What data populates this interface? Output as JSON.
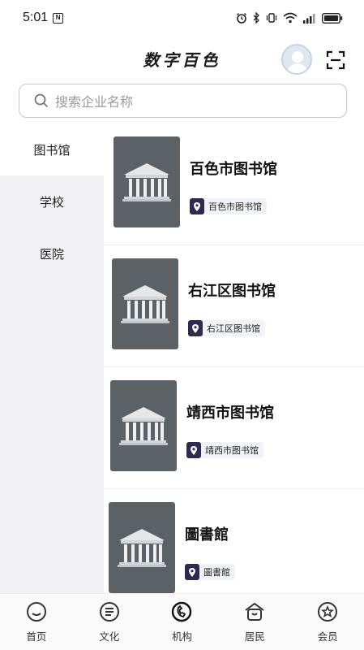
{
  "status_bar": {
    "time": "5:01",
    "nfc_label": "N",
    "icons": [
      "alarm-icon",
      "bluetooth-icon",
      "vibrate-icon",
      "wifi-icon",
      "signal-icon",
      "battery-icon"
    ]
  },
  "header": {
    "title": "数字百色",
    "avatar_icon": "user-avatar",
    "scan_icon": "scan-icon"
  },
  "search": {
    "placeholder": "搜索企业名称"
  },
  "sidebar": {
    "items": [
      {
        "label": "图书馆",
        "active": true
      },
      {
        "label": "学校",
        "active": false
      },
      {
        "label": "医院",
        "active": false
      }
    ]
  },
  "libraries": [
    {
      "title": "百色市图书馆",
      "location": "百色市图书馆"
    },
    {
      "title": "右江区图书馆",
      "location": "右江区图书馆"
    },
    {
      "title": "靖西市图书馆",
      "location": "靖西市图书馆"
    },
    {
      "title": "圖書館",
      "location": "圖書館"
    }
  ],
  "tabbar": {
    "tabs": [
      {
        "label": "首页",
        "icon": "home-icon"
      },
      {
        "label": "文化",
        "icon": "culture-icon"
      },
      {
        "label": "机构",
        "icon": "institution-icon",
        "active": true
      },
      {
        "label": "居民",
        "icon": "residents-icon"
      },
      {
        "label": "会员",
        "icon": "member-icon"
      }
    ]
  },
  "colors": {
    "sidebar_bg": "#f2f2f4",
    "thumb_bg": "#5b6165",
    "badge_pin": "#2d2b52",
    "badge_bg": "#f1f3f8"
  }
}
